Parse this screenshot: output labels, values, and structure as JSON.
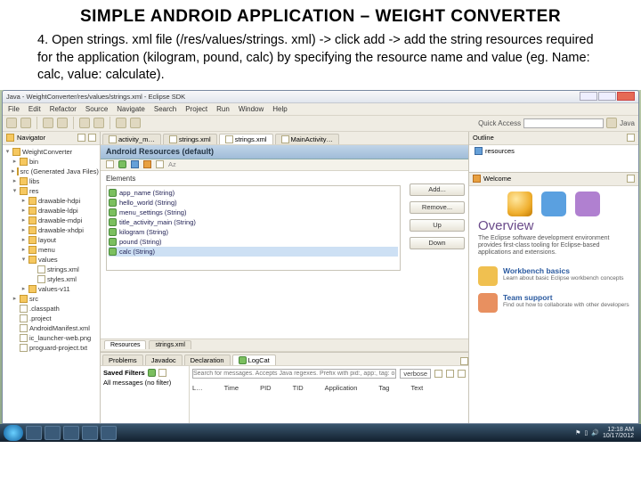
{
  "slide": {
    "title": "SIMPLE ANDROID APPLICATION – WEIGHT CONVERTER",
    "body": "4. Open strings. xml file (/res/values/strings. xml) -> click add -> add the string resources required for the application (kilogram, pound, calc) by specifying the resource name and value (eg. Name: calc, value: calculate)."
  },
  "window": {
    "title": "Java - WeightConverter/res/values/strings.xml - Eclipse SDK",
    "menu": [
      "File",
      "Edit",
      "Refactor",
      "Source",
      "Navigate",
      "Search",
      "Project",
      "Run",
      "Window",
      "Help"
    ],
    "quick_access": "Quick Access",
    "perspective": "Java"
  },
  "navigator": {
    "tab": "Navigator",
    "items": [
      {
        "d": 0,
        "exp": "▾",
        "ico": "folder",
        "t": "WeightConverter"
      },
      {
        "d": 1,
        "exp": "▸",
        "ico": "folder",
        "t": "bin"
      },
      {
        "d": 1,
        "exp": "▸",
        "ico": "folder",
        "t": "src (Generated Java Files)"
      },
      {
        "d": 1,
        "exp": "▸",
        "ico": "folder",
        "t": "libs"
      },
      {
        "d": 1,
        "exp": "▾",
        "ico": "folder",
        "t": "res"
      },
      {
        "d": 2,
        "exp": "▸",
        "ico": "folder",
        "t": "drawable-hdpi"
      },
      {
        "d": 2,
        "exp": "▸",
        "ico": "folder",
        "t": "drawable-ldpi"
      },
      {
        "d": 2,
        "exp": "▸",
        "ico": "folder",
        "t": "drawable-mdpi"
      },
      {
        "d": 2,
        "exp": "▸",
        "ico": "folder",
        "t": "drawable-xhdpi"
      },
      {
        "d": 2,
        "exp": "▸",
        "ico": "folder",
        "t": "layout"
      },
      {
        "d": 2,
        "exp": "▸",
        "ico": "folder",
        "t": "menu"
      },
      {
        "d": 2,
        "exp": "▾",
        "ico": "folder",
        "t": "values"
      },
      {
        "d": 3,
        "exp": "",
        "ico": "file",
        "t": "strings.xml"
      },
      {
        "d": 3,
        "exp": "",
        "ico": "file",
        "t": "styles.xml"
      },
      {
        "d": 2,
        "exp": "▸",
        "ico": "folder",
        "t": "values-v11"
      },
      {
        "d": 1,
        "exp": "▸",
        "ico": "folder",
        "t": "src"
      },
      {
        "d": 1,
        "exp": "",
        "ico": "file",
        "t": ".classpath"
      },
      {
        "d": 1,
        "exp": "",
        "ico": "file",
        "t": ".project"
      },
      {
        "d": 1,
        "exp": "",
        "ico": "file",
        "t": "AndroidManifest.xml"
      },
      {
        "d": 1,
        "exp": "",
        "ico": "file",
        "t": "ic_launcher-web.png"
      },
      {
        "d": 1,
        "exp": "",
        "ico": "file",
        "t": "proguard-project.txt"
      }
    ]
  },
  "editor": {
    "tabs": [
      "activity_m…",
      "strings.xml",
      "strings.xml",
      "MainActivity…"
    ],
    "active_tab": 2,
    "header": "Android Resources (default)",
    "sub_icons_label": "",
    "elements_label": "Elements",
    "elements": [
      {
        "ico": "green",
        "t": "app_name (String)"
      },
      {
        "ico": "green",
        "t": "hello_world (String)"
      },
      {
        "ico": "green",
        "t": "menu_settings (String)"
      },
      {
        "ico": "green",
        "t": "title_activity_main (String)"
      },
      {
        "ico": "green",
        "t": "kilogram (String)"
      },
      {
        "ico": "green",
        "t": "pound (String)"
      },
      {
        "ico": "green",
        "t": "calc (String)"
      }
    ],
    "buttons": {
      "add": "Add...",
      "remove": "Remove...",
      "up": "Up",
      "down": "Down"
    },
    "bottom_tabs": [
      "Resources",
      "strings.xml"
    ]
  },
  "outline": {
    "tab": "Outline",
    "item": "resources"
  },
  "welcome": {
    "tab": "Welcome",
    "heading": "Overview",
    "sub": "The Eclipse software development environment provides first-class tooling for Eclipse-based applications and extensions.",
    "items": [
      {
        "title": "Workbench basics",
        "desc": "Learn about basic Eclipse workbench concepts"
      },
      {
        "title": "Team support",
        "desc": "Find out how to collaborate with other developers"
      }
    ]
  },
  "logcat": {
    "tabs": [
      "Problems",
      "Javadoc",
      "Declaration",
      "LogCat"
    ],
    "saved_filters": "Saved Filters",
    "all_msgs": "All messages (no filter)",
    "hint": "Search for messages. Accepts Java regexes. Prefix with pid:, app:, tag: or text: to limit scope.",
    "cols": [
      "L…",
      "Time",
      "PID",
      "TID",
      "Application",
      "Tag",
      "Text"
    ],
    "verbose": "verbose"
  },
  "tray": {
    "time": "12:18 AM",
    "date": "10/17/2012"
  }
}
